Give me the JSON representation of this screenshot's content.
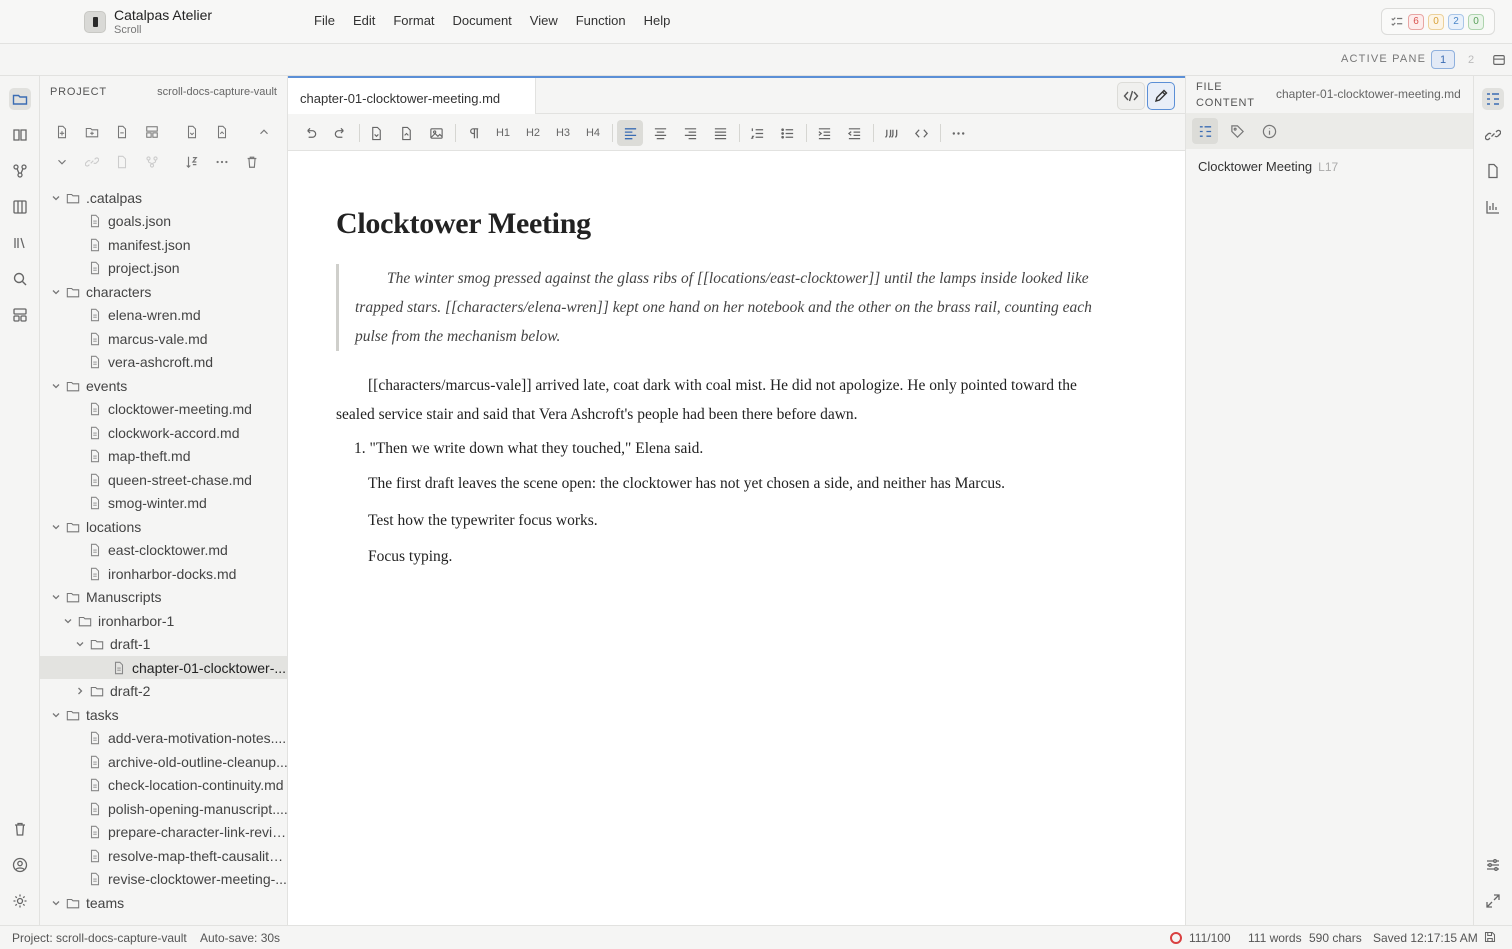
{
  "app": {
    "name": "Catalpas Atelier",
    "subtitle": "Scroll"
  },
  "menu": [
    "File",
    "Edit",
    "Format",
    "Document",
    "View",
    "Function",
    "Help"
  ],
  "task_badges": [
    {
      "value": "6",
      "color": "#d9534f",
      "bg": "#fdecec"
    },
    {
      "value": "0",
      "color": "#d9a23a",
      "bg": "#fdf5e6"
    },
    {
      "value": "2",
      "color": "#4a86c8",
      "bg": "#e9f1fb"
    },
    {
      "value": "0",
      "color": "#5aa15a",
      "bg": "#eaf5ea"
    }
  ],
  "active_pane": {
    "label": "ACTIVE PANE",
    "pane1": "1",
    "pane2": "2"
  },
  "project": {
    "title": "PROJECT",
    "vault": "scroll-docs-capture-vault",
    "tree": [
      {
        "label": ".catalpas",
        "type": "folder",
        "depth": 0,
        "open": true
      },
      {
        "label": "goals.json",
        "type": "file",
        "depth": 1
      },
      {
        "label": "manifest.json",
        "type": "file",
        "depth": 1
      },
      {
        "label": "project.json",
        "type": "file",
        "depth": 1
      },
      {
        "label": "characters",
        "type": "folder",
        "depth": 0,
        "open": true
      },
      {
        "label": "elena-wren.md",
        "type": "file",
        "depth": 1
      },
      {
        "label": "marcus-vale.md",
        "type": "file",
        "depth": 1
      },
      {
        "label": "vera-ashcroft.md",
        "type": "file",
        "depth": 1
      },
      {
        "label": "events",
        "type": "folder",
        "depth": 0,
        "open": true
      },
      {
        "label": "clocktower-meeting.md",
        "type": "file",
        "depth": 1
      },
      {
        "label": "clockwork-accord.md",
        "type": "file",
        "depth": 1
      },
      {
        "label": "map-theft.md",
        "type": "file",
        "depth": 1
      },
      {
        "label": "queen-street-chase.md",
        "type": "file",
        "depth": 1
      },
      {
        "label": "smog-winter.md",
        "type": "file",
        "depth": 1
      },
      {
        "label": "locations",
        "type": "folder",
        "depth": 0,
        "open": true
      },
      {
        "label": "east-clocktower.md",
        "type": "file",
        "depth": 1
      },
      {
        "label": "ironharbor-docks.md",
        "type": "file",
        "depth": 1
      },
      {
        "label": "Manuscripts",
        "type": "folder",
        "depth": 0,
        "open": true
      },
      {
        "label": "ironharbor-1",
        "type": "folder",
        "depth": 1,
        "open": true
      },
      {
        "label": "draft-1",
        "type": "folder",
        "depth": 2,
        "open": true
      },
      {
        "label": "chapter-01-clocktower-...",
        "type": "file",
        "depth": 3,
        "selected": true
      },
      {
        "label": "draft-2",
        "type": "folder",
        "depth": 2,
        "open": false
      },
      {
        "label": "tasks",
        "type": "folder",
        "depth": 0,
        "open": true
      },
      {
        "label": "add-vera-motivation-notes....",
        "type": "file",
        "depth": 1
      },
      {
        "label": "archive-old-outline-cleanup...",
        "type": "file",
        "depth": 1
      },
      {
        "label": "check-location-continuity.md",
        "type": "file",
        "depth": 1
      },
      {
        "label": "polish-opening-manuscript....",
        "type": "file",
        "depth": 1
      },
      {
        "label": "prepare-character-link-revie...",
        "type": "file",
        "depth": 1
      },
      {
        "label": "resolve-map-theft-causality....",
        "type": "file",
        "depth": 1
      },
      {
        "label": "revise-clocktower-meeting-...",
        "type": "file",
        "depth": 1
      },
      {
        "label": "teams",
        "type": "folder",
        "depth": 0,
        "open": true
      }
    ]
  },
  "editor": {
    "tab": "chapter-01-clocktower-meeting.md",
    "heading": "Clocktower Meeting",
    "quote": "The winter smog pressed against the glass ribs of [[locations/east-clocktower]] until the lamps inside looked like trapped stars. [[characters/elena-wren]] kept one hand on her notebook and the other on the brass rail, counting each pulse from the mechanism below.",
    "paragraph": "[[characters/marcus-vale]] arrived late, coat dark with coal mist. He did not apologize. He only pointed toward the sealed service stair and said that Vera Ashcroft's people had been there before dawn.",
    "list_item": "\"Then we write down what they touched,\" Elena said.",
    "list_marker": "1.",
    "p_first_draft": "The first draft leaves the scene open: the clocktower has not yet chosen a side, and neither has Marcus.",
    "p_test": "Test how the typewriter focus works.",
    "p_focus": "Focus typing.",
    "toolbar": {
      "h1": "H1",
      "h2": "H2",
      "h3": "H3",
      "h4": "H4"
    }
  },
  "right_panel": {
    "title_line1": "FILE",
    "title_line2": "CONTENT",
    "file": "chapter-01-clocktower-meeting.md",
    "outline": [
      {
        "label": "Clocktower Meeting",
        "line": "L17"
      }
    ]
  },
  "status": {
    "project": "Project: scroll-docs-capture-vault",
    "autosave": "Auto-save: 30s",
    "goal": "111/100",
    "words": "111 words",
    "chars": "590 chars",
    "saved": "Saved 12:17:15 AM"
  },
  "colors": {
    "accent": "#5b8fd6",
    "error": "#d94040"
  }
}
